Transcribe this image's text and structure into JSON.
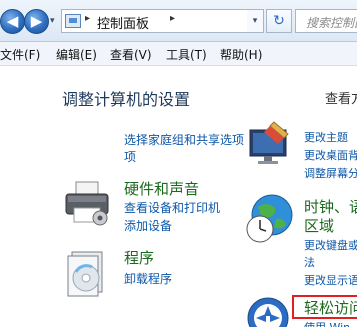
{
  "navbar": {
    "back_glyph": "◀",
    "forward_glyph": "▶",
    "dropdown_glyph": "▾",
    "address_sep": "▸",
    "address_path": "控制面板",
    "address_dropdown_glyph": "▾",
    "refresh_glyph": "↻",
    "search_placeholder": "搜索控制面"
  },
  "menubar": {
    "items": [
      "文件(F)",
      "编辑(E)",
      "查看(V)",
      "工具(T)",
      "帮助(H)"
    ]
  },
  "main": {
    "title": "调整计算机的设置",
    "view_by": "查看方"
  },
  "categories": {
    "network": {
      "link": "选择家庭组和共享选项"
    },
    "hardware": {
      "title": "硬件和声音",
      "links": [
        "查看设备和打印机",
        "添加设备"
      ]
    },
    "programs": {
      "title": "程序",
      "links": [
        "卸载程序"
      ]
    },
    "appearance": {
      "links": [
        "更改主题",
        "更改桌面背",
        "调整屏幕分"
      ]
    },
    "clock": {
      "title_line1": "时钟、语",
      "title_line2": "区域",
      "links": [
        "更改键盘或",
        "法",
        "更改显示语"
      ]
    },
    "ease": {
      "title": "轻松访问",
      "link": "使用 Win"
    }
  },
  "icons": {
    "printer": "printer-icon",
    "programs": "programs-disc-icon",
    "appearance": "display-brush-icon",
    "clock": "globe-clock-icon",
    "ease": "ease-of-access-icon"
  },
  "colors": {
    "category_title": "#1a6a1d",
    "link": "#0d57a8",
    "highlight": "#e02020"
  }
}
